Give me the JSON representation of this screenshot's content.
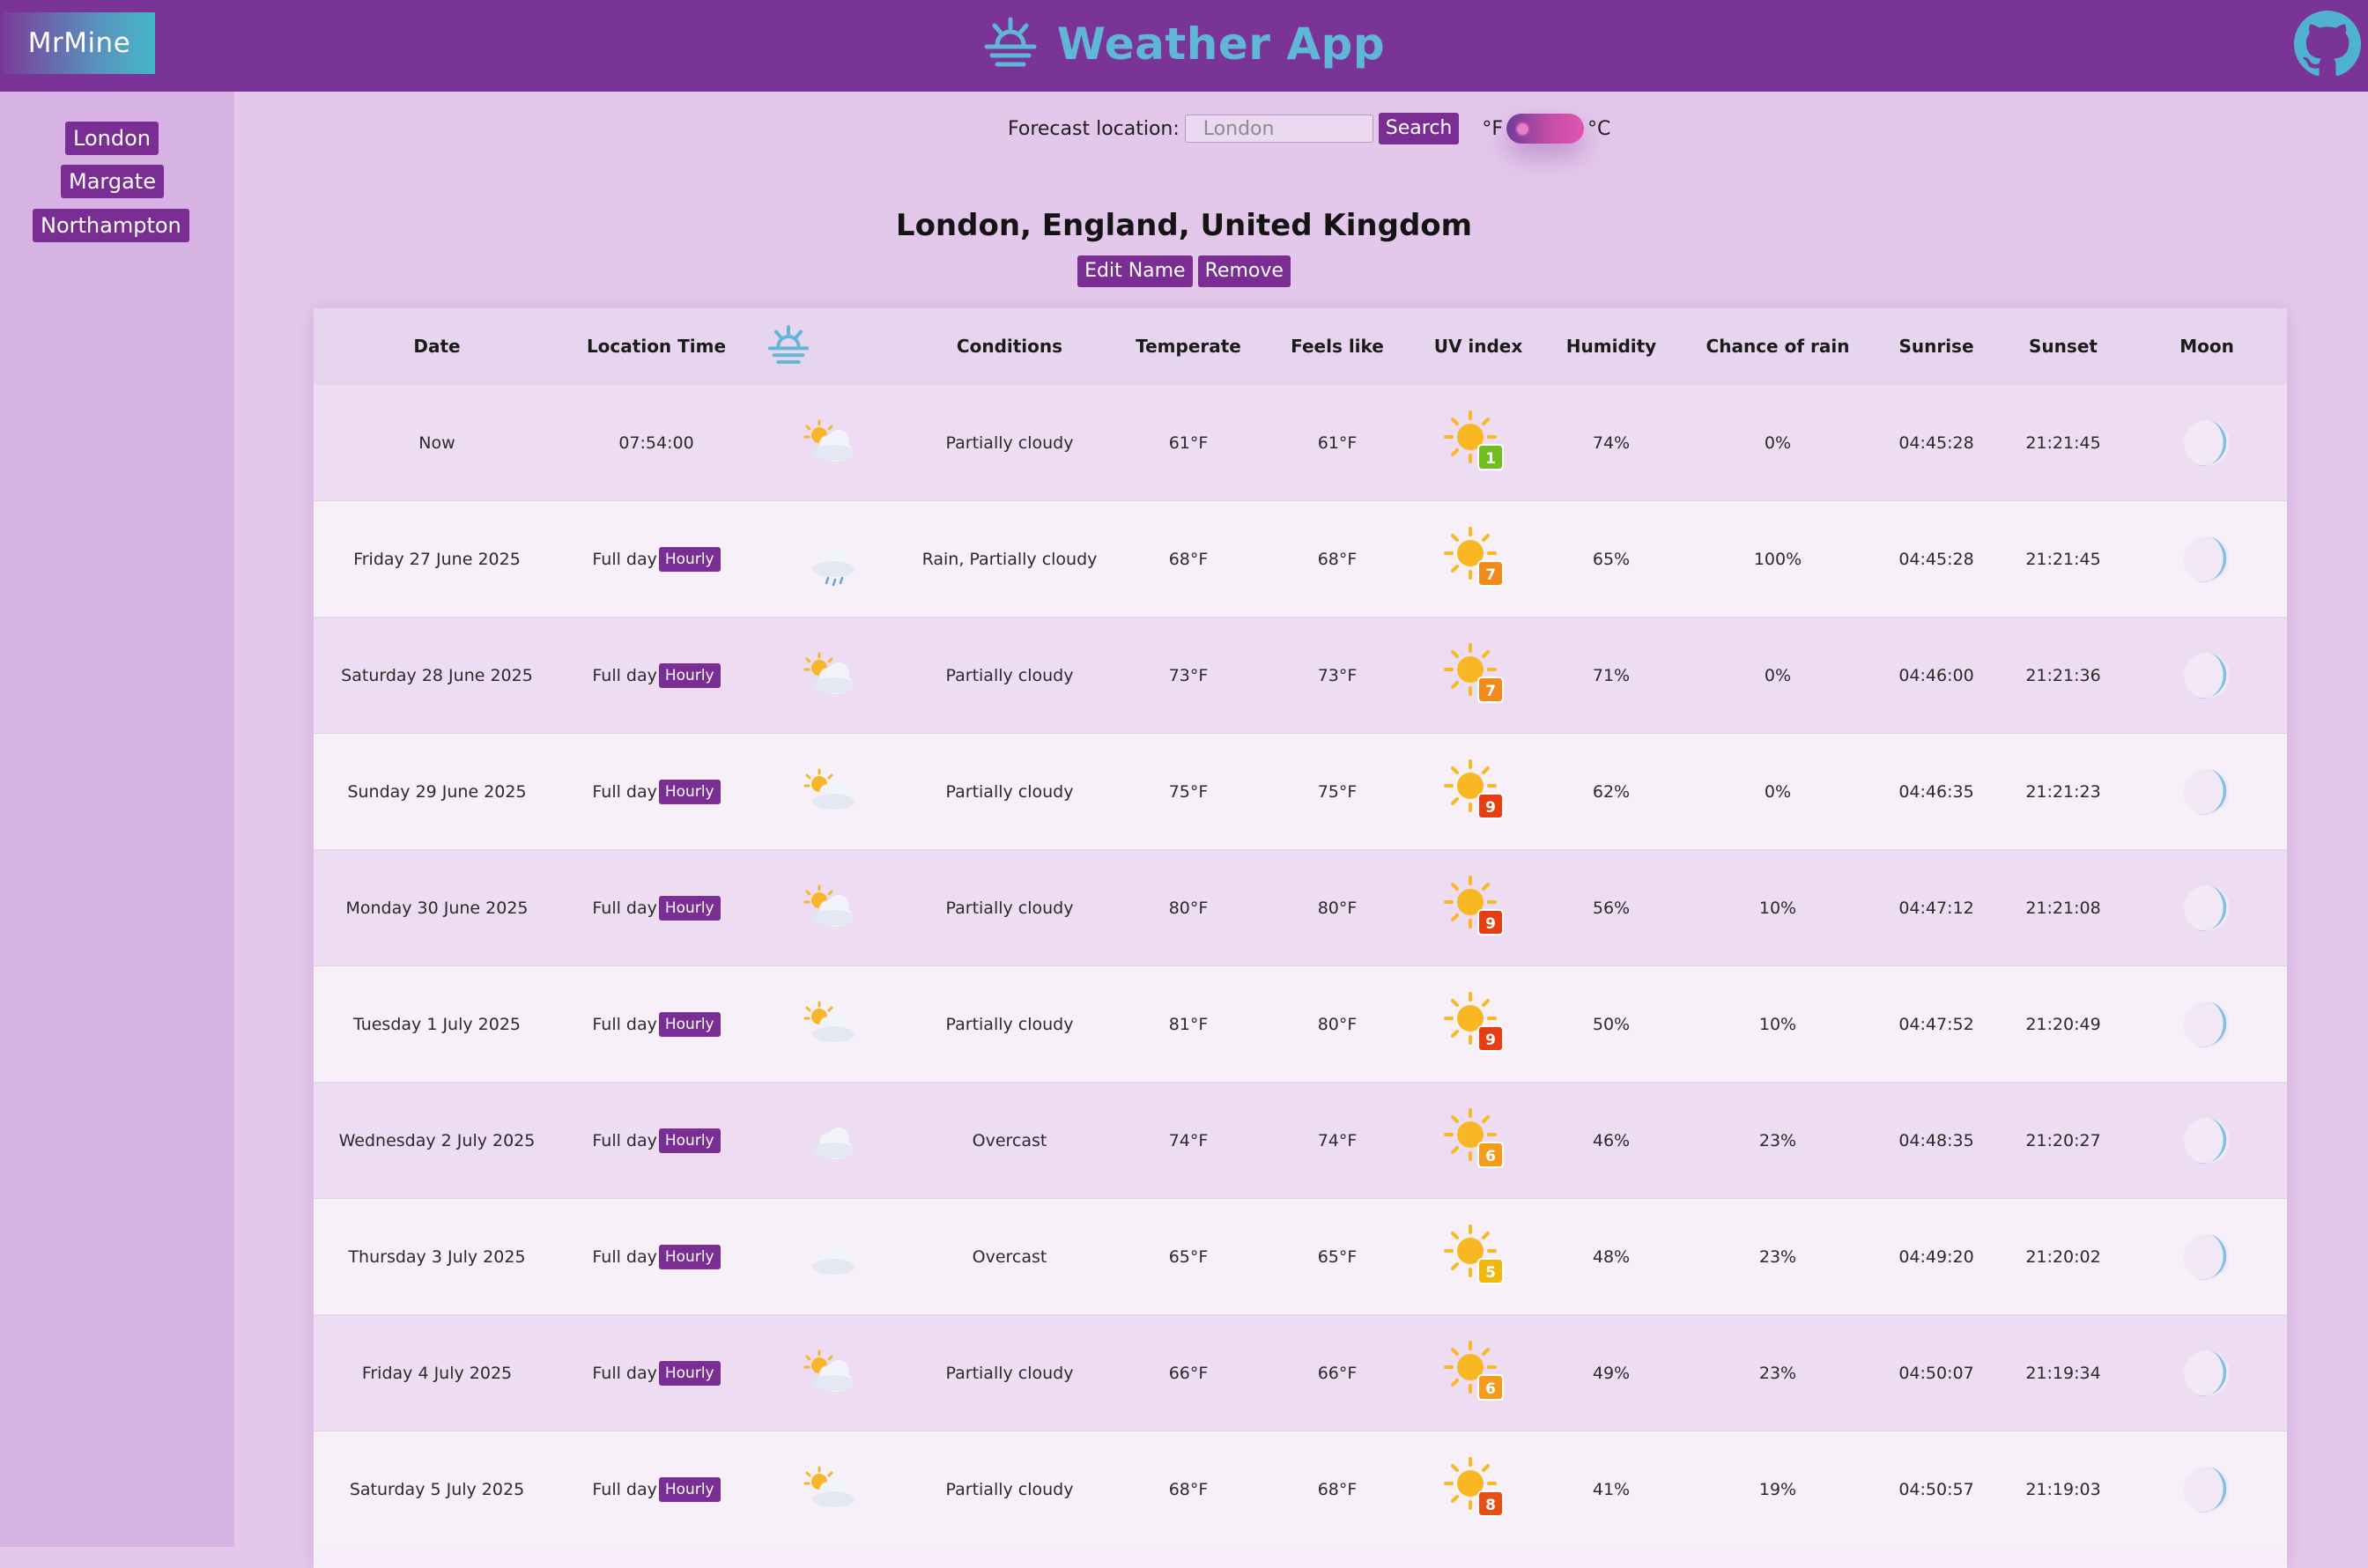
{
  "brand": "MrMine",
  "app_title": "Weather App",
  "sidebar": {
    "items": [
      {
        "label": "London"
      },
      {
        "label": "Margate"
      },
      {
        "label": "Northampton"
      }
    ]
  },
  "search": {
    "label": "Forecast location:",
    "placeholder": "London",
    "button": "Search",
    "unit_f": "°F",
    "unit_c": "°C"
  },
  "location": {
    "heading": "London, England, United Kingdom",
    "edit_label": "Edit Name",
    "remove_label": "Remove"
  },
  "table": {
    "headers": {
      "date": "Date",
      "location_time": "Location Time",
      "conditions": "Conditions",
      "temperature": "Temperate",
      "feels_like": "Feels like",
      "uv_index": "UV index",
      "humidity": "Humidity",
      "chance_of_rain": "Chance of rain",
      "sunrise": "Sunrise",
      "sunset": "Sunset",
      "moon": "Moon"
    },
    "full_day_label": "Full day",
    "hourly_label": "Hourly",
    "rows": [
      {
        "date": "Now",
        "time": "07:54:00",
        "icon": "partly-cloudy-icon",
        "conditions": "Partially cloudy",
        "temp": "61°F",
        "feels": "61°F",
        "uv": "1",
        "uv_color": "#6fbf1f",
        "humidity": "74%",
        "rain": "0%",
        "sunrise": "04:45:28",
        "sunset": "21:21:45"
      },
      {
        "date": "Friday 27 June 2025",
        "time": "",
        "icon": "rain-cloud-icon",
        "conditions": "Rain, Partially cloudy",
        "temp": "68°F",
        "feels": "68°F",
        "uv": "7",
        "uv_color": "#f08a1a",
        "humidity": "65%",
        "rain": "100%",
        "sunrise": "04:45:28",
        "sunset": "21:21:45"
      },
      {
        "date": "Saturday 28 June 2025",
        "time": "",
        "icon": "partly-cloudy-icon",
        "conditions": "Partially cloudy",
        "temp": "73°F",
        "feels": "73°F",
        "uv": "7",
        "uv_color": "#f08a1a",
        "humidity": "71%",
        "rain": "0%",
        "sunrise": "04:46:00",
        "sunset": "21:21:36"
      },
      {
        "date": "Sunday 29 June 2025",
        "time": "",
        "icon": "partly-cloudy-icon",
        "conditions": "Partially cloudy",
        "temp": "75°F",
        "feels": "75°F",
        "uv": "9",
        "uv_color": "#e63d12",
        "humidity": "62%",
        "rain": "0%",
        "sunrise": "04:46:35",
        "sunset": "21:21:23"
      },
      {
        "date": "Monday 30 June 2025",
        "time": "",
        "icon": "partly-cloudy-icon",
        "conditions": "Partially cloudy",
        "temp": "80°F",
        "feels": "80°F",
        "uv": "9",
        "uv_color": "#e63d12",
        "humidity": "56%",
        "rain": "10%",
        "sunrise": "04:47:12",
        "sunset": "21:21:08"
      },
      {
        "date": "Tuesday 1 July 2025",
        "time": "",
        "icon": "partly-cloudy-icon",
        "conditions": "Partially cloudy",
        "temp": "81°F",
        "feels": "80°F",
        "uv": "9",
        "uv_color": "#e63d12",
        "humidity": "50%",
        "rain": "10%",
        "sunrise": "04:47:52",
        "sunset": "21:20:49"
      },
      {
        "date": "Wednesday 2 July 2025",
        "time": "",
        "icon": "overcast-icon",
        "conditions": "Overcast",
        "temp": "74°F",
        "feels": "74°F",
        "uv": "6",
        "uv_color": "#f59a1a",
        "humidity": "46%",
        "rain": "23%",
        "sunrise": "04:48:35",
        "sunset": "21:20:27"
      },
      {
        "date": "Thursday 3 July 2025",
        "time": "",
        "icon": "overcast-icon",
        "conditions": "Overcast",
        "temp": "65°F",
        "feels": "65°F",
        "uv": "5",
        "uv_color": "#f2b70e",
        "humidity": "48%",
        "rain": "23%",
        "sunrise": "04:49:20",
        "sunset": "21:20:02"
      },
      {
        "date": "Friday 4 July 2025",
        "time": "",
        "icon": "partly-cloudy-icon",
        "conditions": "Partially cloudy",
        "temp": "66°F",
        "feels": "66°F",
        "uv": "6",
        "uv_color": "#f59a1a",
        "humidity": "49%",
        "rain": "23%",
        "sunrise": "04:50:07",
        "sunset": "21:19:34"
      },
      {
        "date": "Saturday 5 July 2025",
        "time": "",
        "icon": "partly-cloudy-icon",
        "conditions": "Partially cloudy",
        "temp": "68°F",
        "feels": "68°F",
        "uv": "8",
        "uv_color": "#e84e16",
        "humidity": "41%",
        "rain": "19%",
        "sunrise": "04:50:57",
        "sunset": "21:19:03"
      }
    ]
  },
  "colors": {
    "topbar": "#7a3498",
    "accent": "#7a2e94",
    "title": "#5fb6d6",
    "page_bg": "#e4c8ec",
    "sidebar_bg": "#d6b3e2"
  }
}
